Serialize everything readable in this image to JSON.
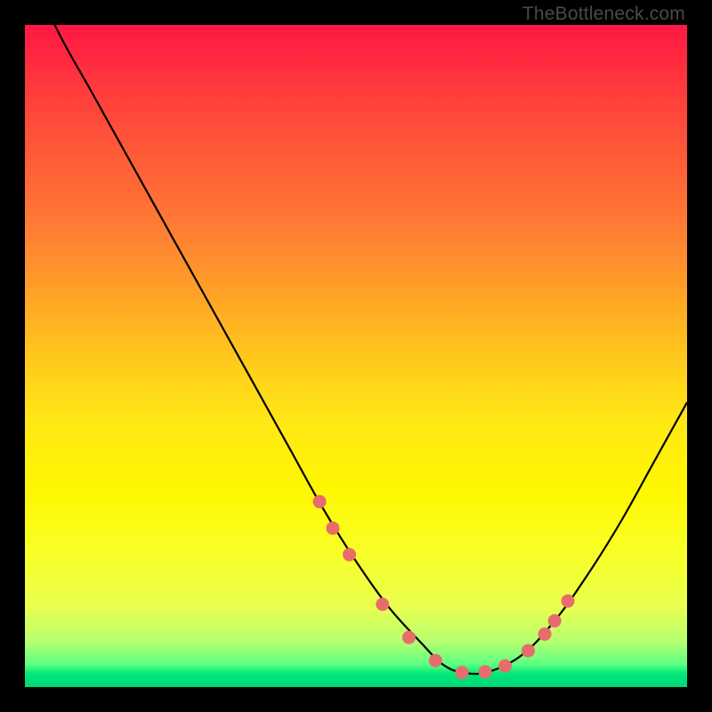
{
  "watermark": "TheBottleneck.com",
  "chart_data": {
    "type": "line",
    "title": "",
    "xlabel": "",
    "ylabel": "",
    "xlim": [
      0,
      100
    ],
    "ylim": [
      0,
      100
    ],
    "series": [
      {
        "name": "bottleneck-curve",
        "x": [
          0,
          5,
          10,
          15,
          20,
          25,
          30,
          35,
          40,
          45,
          50,
          55,
          60,
          63,
          66,
          70,
          75,
          80,
          85,
          90,
          95,
          100
        ],
        "values": [
          110,
          99,
          90,
          81,
          72,
          63,
          54,
          45,
          36,
          27,
          19,
          12,
          6.5,
          3.5,
          2.2,
          2.3,
          4.8,
          10,
          17,
          25,
          34,
          43
        ]
      }
    ],
    "markers": {
      "name": "highlight-dots",
      "color": "#e86c6c",
      "x": [
        44.5,
        46.5,
        49.0,
        54.0,
        58.0,
        62.0,
        66.0,
        69.5,
        72.5,
        76.0,
        78.5,
        80.0,
        82.0
      ],
      "y": [
        28.0,
        24.0,
        20.0,
        12.5,
        7.5,
        4.0,
        2.2,
        2.3,
        3.2,
        5.5,
        8.0,
        10.0,
        13.0
      ]
    }
  }
}
